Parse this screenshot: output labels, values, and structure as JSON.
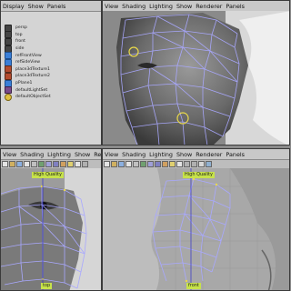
{
  "outliner": {
    "menus": [
      "Display",
      "Show",
      "Panels"
    ],
    "items": [
      {
        "label": "persp",
        "icon": "camera-icon"
      },
      {
        "label": "top",
        "icon": "camera-icon"
      },
      {
        "label": "front",
        "icon": "camera-icon"
      },
      {
        "label": "side",
        "icon": "camera-icon"
      },
      {
        "label": "refFrontView",
        "icon": "plane-icon"
      },
      {
        "label": "refSideView",
        "icon": "plane-icon"
      },
      {
        "label": "place3dTexture1",
        "icon": "texture-icon"
      },
      {
        "label": "place3dTexture2",
        "icon": "texture-icon"
      },
      {
        "label": "pPlane1",
        "icon": "plane-icon"
      },
      {
        "label": "defaultLightSet",
        "icon": "light-set-icon"
      },
      {
        "label": "defaultObjectSet",
        "icon": "object-set-icon"
      }
    ]
  },
  "viewports": {
    "top_right_menus": [
      "View",
      "Shading",
      "Lighting",
      "Show",
      "Renderer",
      "Panels"
    ],
    "bottom_left_menus": [
      "View",
      "Shading",
      "Lighting",
      "Show",
      "Rend"
    ],
    "bottom_right_menus": [
      "View",
      "Shading",
      "Lighting",
      "Show",
      "Renderer",
      "Panels"
    ]
  },
  "colors": {
    "wire": "#a9a8ff",
    "wire_selected": "#e9d94a",
    "viewport_bg": "#7b7b7b"
  }
}
